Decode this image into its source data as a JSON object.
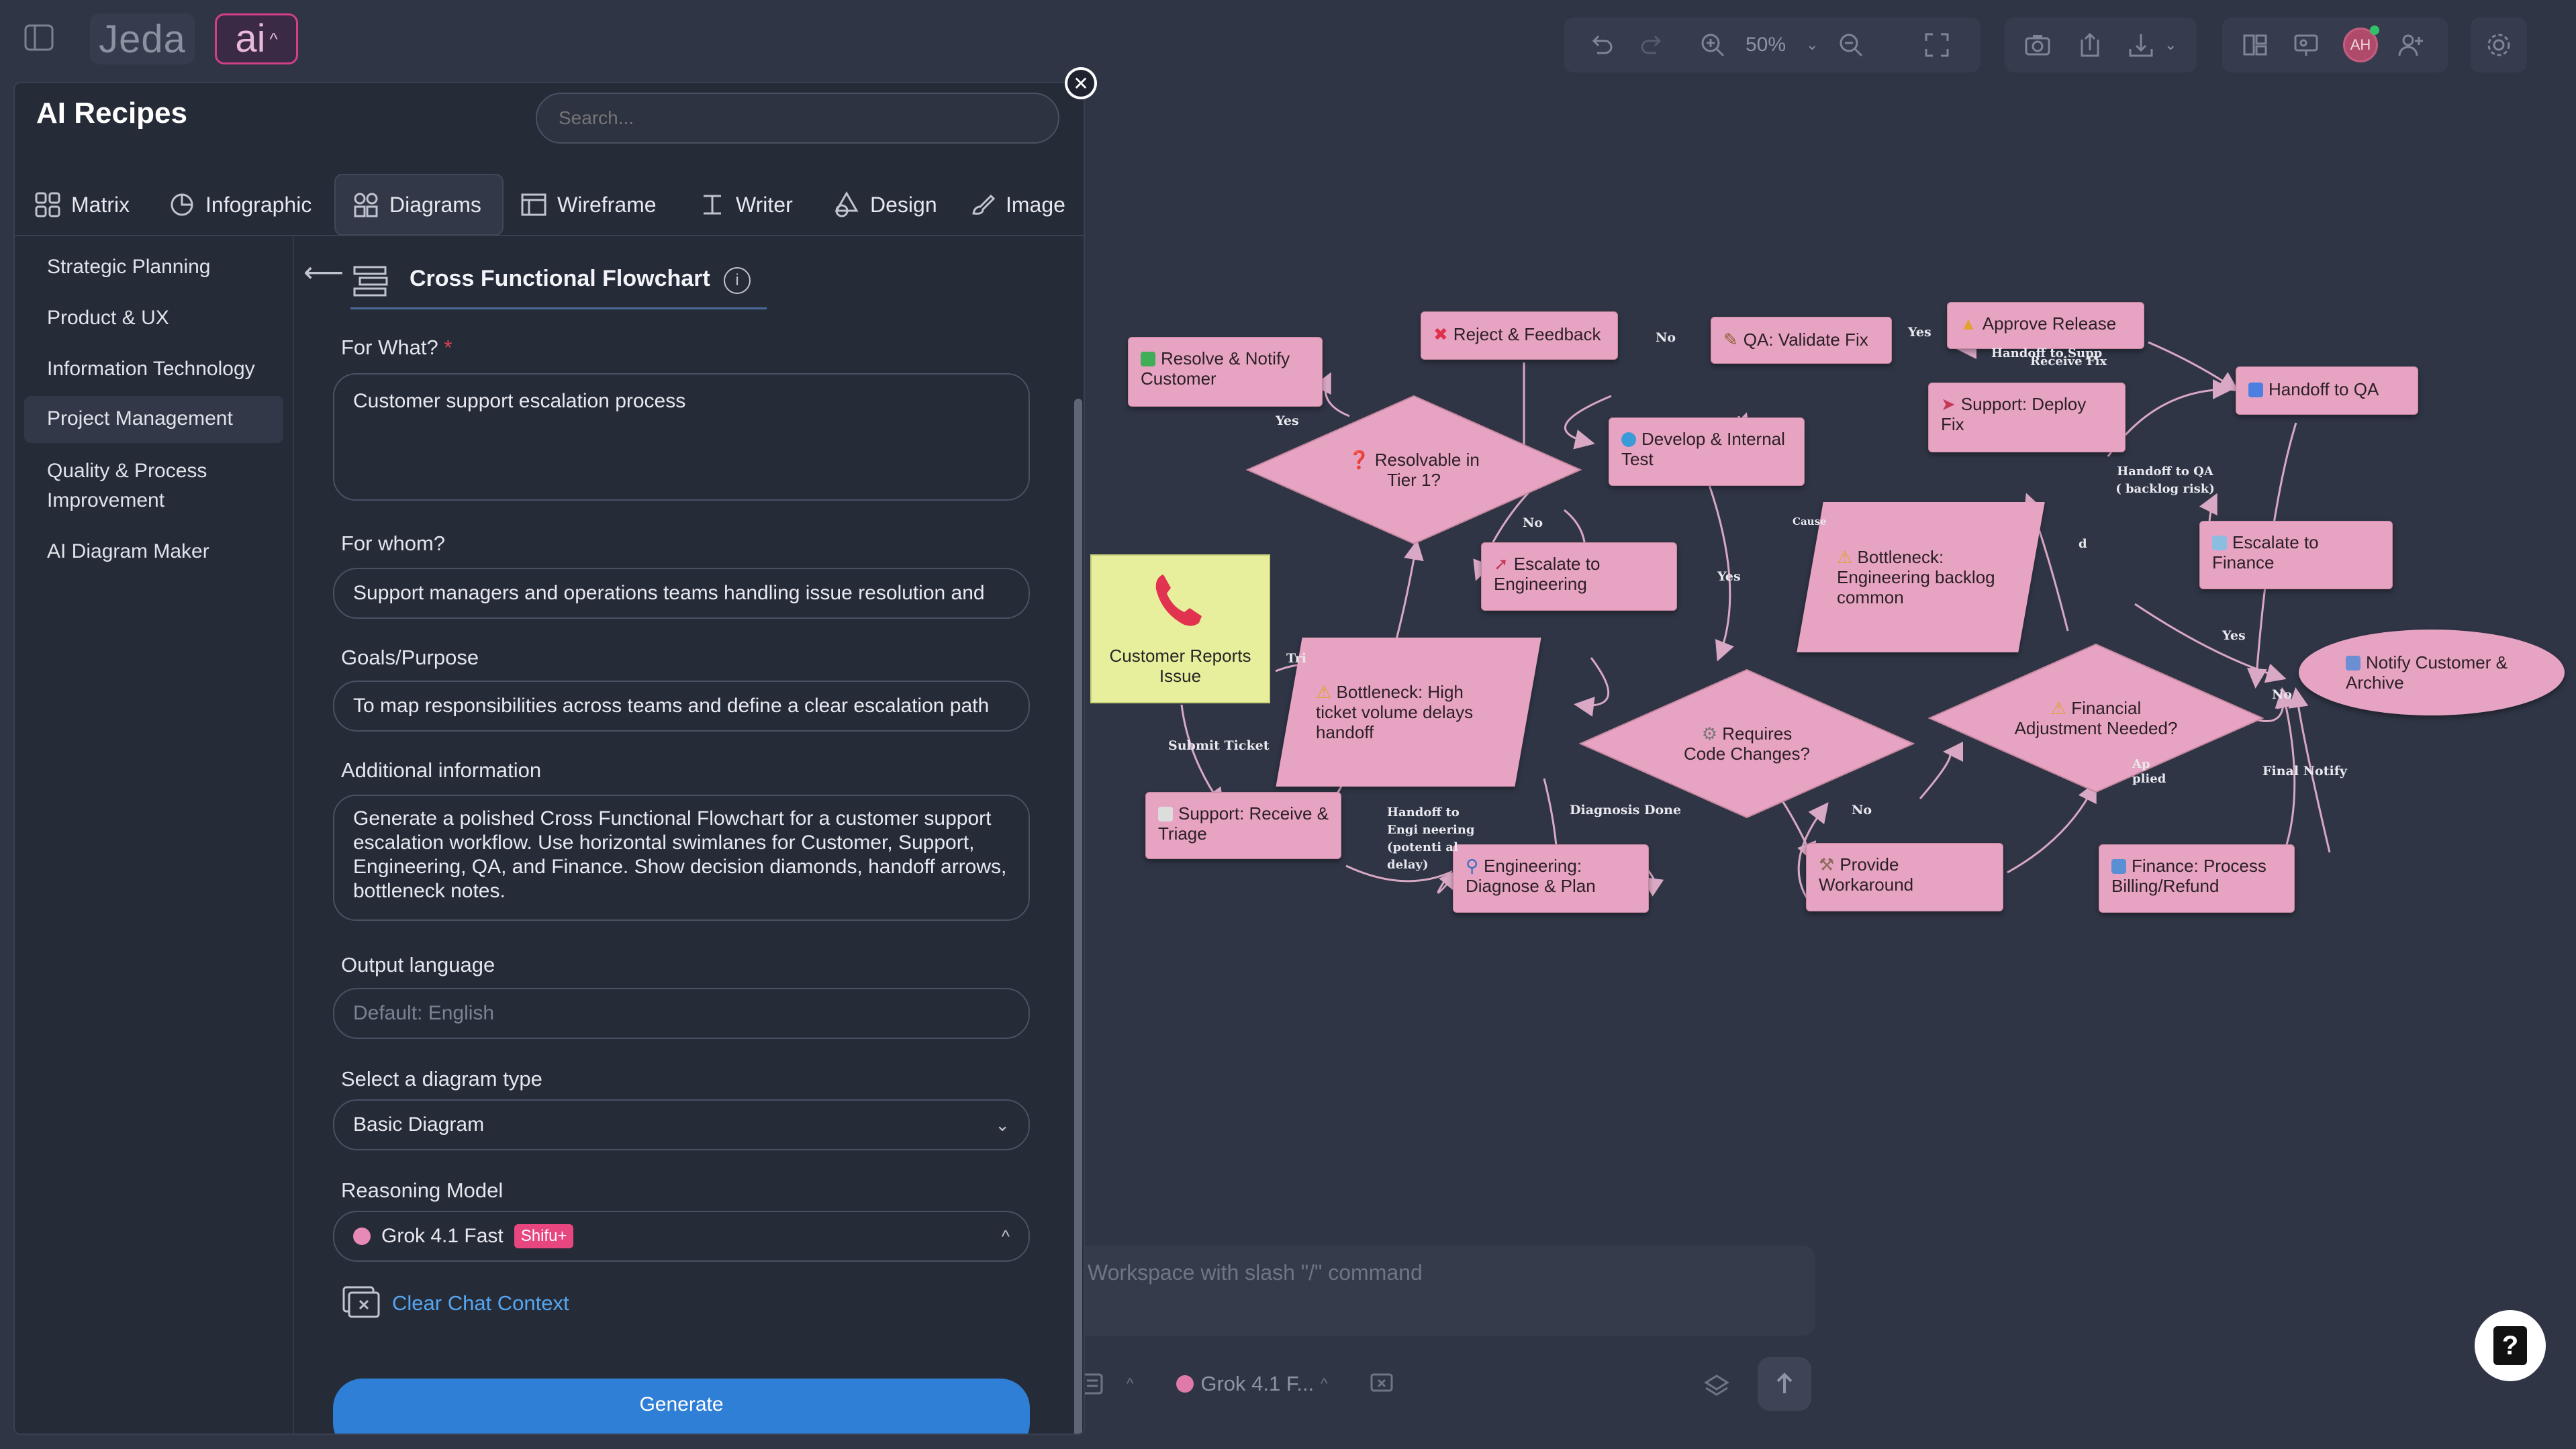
{
  "topbar": {
    "logo": "Jeda",
    "ai_label": "ai",
    "zoom": "50%",
    "avatar": "AH"
  },
  "panel": {
    "title": "AI Recipes",
    "search_placeholder": "Search...",
    "tabs": [
      {
        "label": "Matrix"
      },
      {
        "label": "Infographic"
      },
      {
        "label": "Diagrams"
      },
      {
        "label": "Wireframe"
      },
      {
        "label": "Writer"
      },
      {
        "label": "Design"
      },
      {
        "label": "Image"
      }
    ],
    "active_tab": "Diagrams",
    "categories": [
      {
        "label": "Strategic Planning"
      },
      {
        "label": "Product & UX"
      },
      {
        "label": "Information Technology"
      },
      {
        "label": "Project Management"
      },
      {
        "label": "Quality & Process Improvement"
      },
      {
        "label": "AI Diagram Maker"
      }
    ],
    "active_category": "Project Management",
    "recipe": {
      "title": "Cross Functional Flowchart",
      "info": "i"
    },
    "form": {
      "for_what_label": "For What?",
      "required_mark": "*",
      "for_what_value": "Customer support escalation process",
      "for_whom_label": "For whom?",
      "for_whom_value": "Support managers and operations teams handling issue resolution and",
      "goals_label": "Goals/Purpose",
      "goals_value": "To map responsibilities across teams and define a clear escalation path",
      "additional_label": "Additional information",
      "additional_value": "Generate a polished Cross Functional Flowchart for a customer support escalation workflow. Use horizontal swimlanes for Customer, Support, Engineering, QA, and Finance. Show decision diamonds, handoff arrows, bottleneck notes.",
      "output_language_label": "Output language",
      "output_language_placeholder": "Default: English",
      "diagram_type_label": "Select a diagram type",
      "diagram_type_value": "Basic Diagram",
      "reasoning_label": "Reasoning Model",
      "reasoning_value": "Grok 4.1 Fast",
      "reasoning_badge": "Shifu+",
      "clear_context": "Clear Chat Context",
      "generate": "Generate"
    }
  },
  "chat": {
    "placeholder": "Workspace with slash \"/\" command",
    "model": "Grok 4.1 F..."
  },
  "help": "?",
  "diagram": {
    "start": "Customer Reports Issue",
    "nodes": {
      "resolve_notify": "Resolve & Notify Customer",
      "reject_feedback": "Reject & Feedback",
      "qa_validate": "QA: Validate Fix",
      "approve_release": "Approve Release",
      "handoff_qa": "Handoff to QA",
      "support_deploy": "Support: Deploy Fix",
      "develop_test": "Develop & Internal Test",
      "escalate_eng": "Escalate to Engineering",
      "bottleneck_eng": "Bottleneck: Engineering backlog common",
      "escalate_fin": "Escalate to Finance",
      "notify_archive": "Notify Customer & Archive",
      "bottleneck_ticket": "Bottleneck: High ticket volume delays handoff",
      "support_receive": "Support: Receive & Triage",
      "eng_diagnose": "Engineering: Diagnose & Plan",
      "provide_workaround": "Provide Workaround",
      "finance_process": "Finance: Process Billing/Refund"
    },
    "decisions": {
      "tier1": "Resolvable in Tier 1?",
      "code": "Requires Code Changes?",
      "financial": "Financial Adjustment Needed?"
    },
    "edge_labels": {
      "no1": "No",
      "yes1": "Yes",
      "yes2": "Yes",
      "no2": "No",
      "yes3": "Yes",
      "no3": "No",
      "yes4": "Yes",
      "no4": "No",
      "cause": "Cause",
      "submit": "Submit Ticket",
      "tri": "Tri",
      "handoff_eng": "Handoff to Engi neering (potenti al delay)",
      "diagnosis": "Diagnosis Done",
      "handoff_qa_backlog": "Handoff to QA ( backlog risk)",
      "final_notify": "Final Notify",
      "receive_fix": "Receive Fix",
      "handoff_sys": "Handoff to Supp",
      "applied": "Ap plied",
      "d": "d"
    }
  }
}
